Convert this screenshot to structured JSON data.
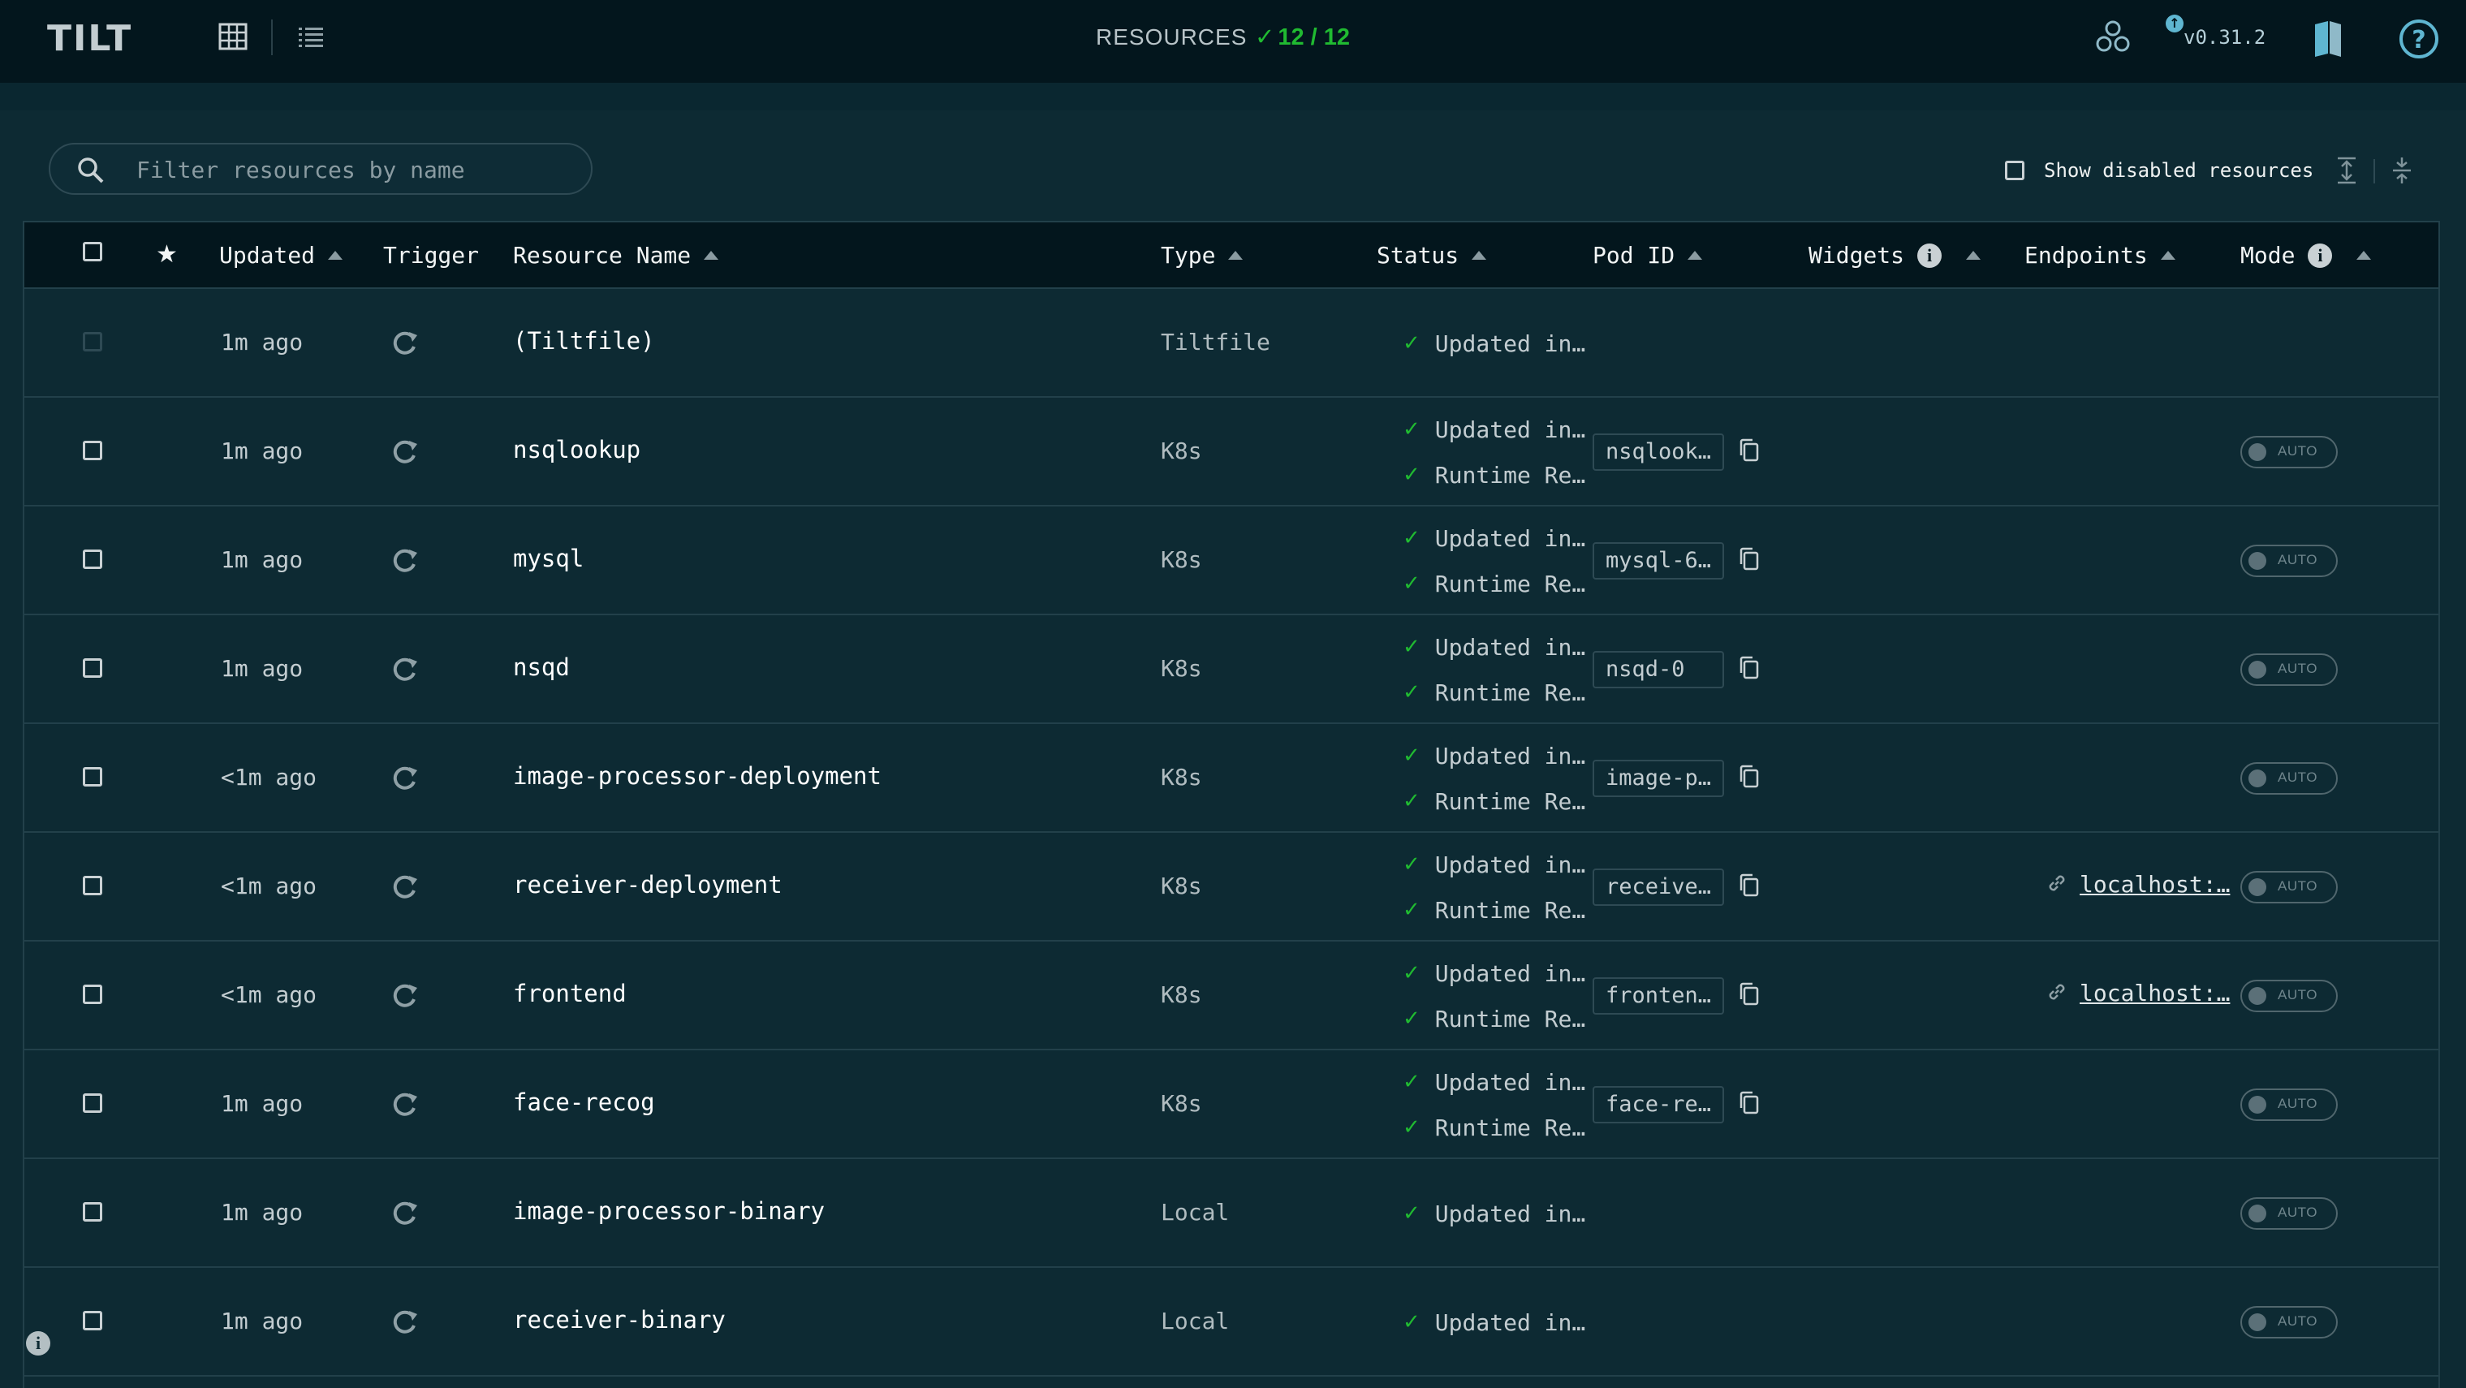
{
  "header": {
    "logo_text": "TILT",
    "resources_label": "RESOURCES",
    "resources_count": "12 / 12",
    "version": "v0.31.2"
  },
  "filter": {
    "placeholder": "Filter resources by name",
    "value": ""
  },
  "show_disabled_label": "Show disabled resources",
  "table": {
    "columns": {
      "updated": "Updated",
      "trigger": "Trigger",
      "name": "Resource Name",
      "type": "Type",
      "status": "Status",
      "pod_id": "Pod ID",
      "widgets": "Widgets",
      "endpoints": "Endpoints",
      "mode": "Mode"
    },
    "mode_toggle_label": "AUTO",
    "rows": [
      {
        "updated": "1m ago",
        "name": "(Tiltfile)",
        "type": "Tiltfile",
        "status1": "Updated in…",
        "status2": "",
        "pod": "",
        "endpoint": "",
        "has_toggle": false,
        "checkbox_disabled": true
      },
      {
        "updated": "1m ago",
        "name": "nsqlookup",
        "type": "K8s",
        "status1": "Updated in…",
        "status2": "Runtime Re…",
        "pod": "nsqlook…",
        "endpoint": "",
        "has_toggle": true,
        "checkbox_disabled": false
      },
      {
        "updated": "1m ago",
        "name": "mysql",
        "type": "K8s",
        "status1": "Updated in…",
        "status2": "Runtime Re…",
        "pod": "mysql-6…",
        "endpoint": "",
        "has_toggle": true,
        "checkbox_disabled": false
      },
      {
        "updated": "1m ago",
        "name": "nsqd",
        "type": "K8s",
        "status1": "Updated in…",
        "status2": "Runtime Re…",
        "pod": "nsqd-0",
        "endpoint": "",
        "has_toggle": true,
        "checkbox_disabled": false
      },
      {
        "updated": "<1m ago",
        "name": "image-processor-deployment",
        "type": "K8s",
        "status1": "Updated in…",
        "status2": "Runtime Re…",
        "pod": "image-p…",
        "endpoint": "",
        "has_toggle": true,
        "checkbox_disabled": false
      },
      {
        "updated": "<1m ago",
        "name": "receiver-deployment",
        "type": "K8s",
        "status1": "Updated in…",
        "status2": "Runtime Re…",
        "pod": "receive…",
        "endpoint": "localhost:…",
        "has_toggle": true,
        "checkbox_disabled": false
      },
      {
        "updated": "<1m ago",
        "name": "frontend",
        "type": "K8s",
        "status1": "Updated in…",
        "status2": "Runtime Re…",
        "pod": "fronten…",
        "endpoint": "localhost:…",
        "has_toggle": true,
        "checkbox_disabled": false
      },
      {
        "updated": "1m ago",
        "name": "face-recog",
        "type": "K8s",
        "status1": "Updated in…",
        "status2": "Runtime Re…",
        "pod": "face-re…",
        "endpoint": "",
        "has_toggle": true,
        "checkbox_disabled": false
      },
      {
        "updated": "1m ago",
        "name": "image-processor-binary",
        "type": "Local",
        "status1": "Updated in…",
        "status2": "",
        "pod": "",
        "endpoint": "",
        "has_toggle": true,
        "checkbox_disabled": false
      },
      {
        "updated": "1m ago",
        "name": "receiver-binary",
        "type": "Local",
        "status1": "Updated in…",
        "status2": "",
        "pod": "",
        "endpoint": "",
        "has_toggle": true,
        "checkbox_disabled": false
      }
    ]
  },
  "colors": {
    "background": "#0d2a33",
    "topbar": "#03161d",
    "accent_green": "#20ba31",
    "text": "#eef1f1"
  },
  "icons": {
    "view_table": "grid-icon",
    "view_list": "list-icon",
    "snapshot": "snapshot-icon",
    "version_update": "update-available-icon",
    "docs": "book-icon",
    "help": "help-icon"
  }
}
